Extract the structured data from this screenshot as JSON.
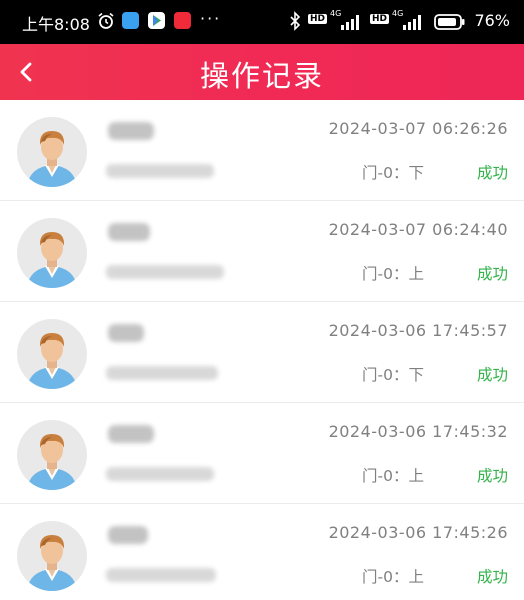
{
  "status_bar": {
    "time": "上午8:08",
    "more": "···",
    "network_1": "4G",
    "network_2": "4G",
    "hd_1": "HD",
    "hd_2": "HD",
    "battery_percent": "76%"
  },
  "header": {
    "title": "操作记录",
    "back_icon": "chevron-left-icon"
  },
  "records": [
    {
      "time": "2024-03-07 06:26:26",
      "door": "门-0：下",
      "status": "成功"
    },
    {
      "time": "2024-03-07 06:24:40",
      "door": "门-0：上",
      "status": "成功"
    },
    {
      "time": "2024-03-06 17:45:57",
      "door": "门-0：下",
      "status": "成功"
    },
    {
      "time": "2024-03-06 17:45:32",
      "door": "门-0：上",
      "status": "成功"
    },
    {
      "time": "2024-03-06 17:45:26",
      "door": "门-0：上",
      "status": "成功"
    }
  ],
  "colors": {
    "header_gradient_start": "#f0344f",
    "header_gradient_end": "#ee2756",
    "status_success": "#33b34a",
    "secondary_text": "#808080"
  }
}
